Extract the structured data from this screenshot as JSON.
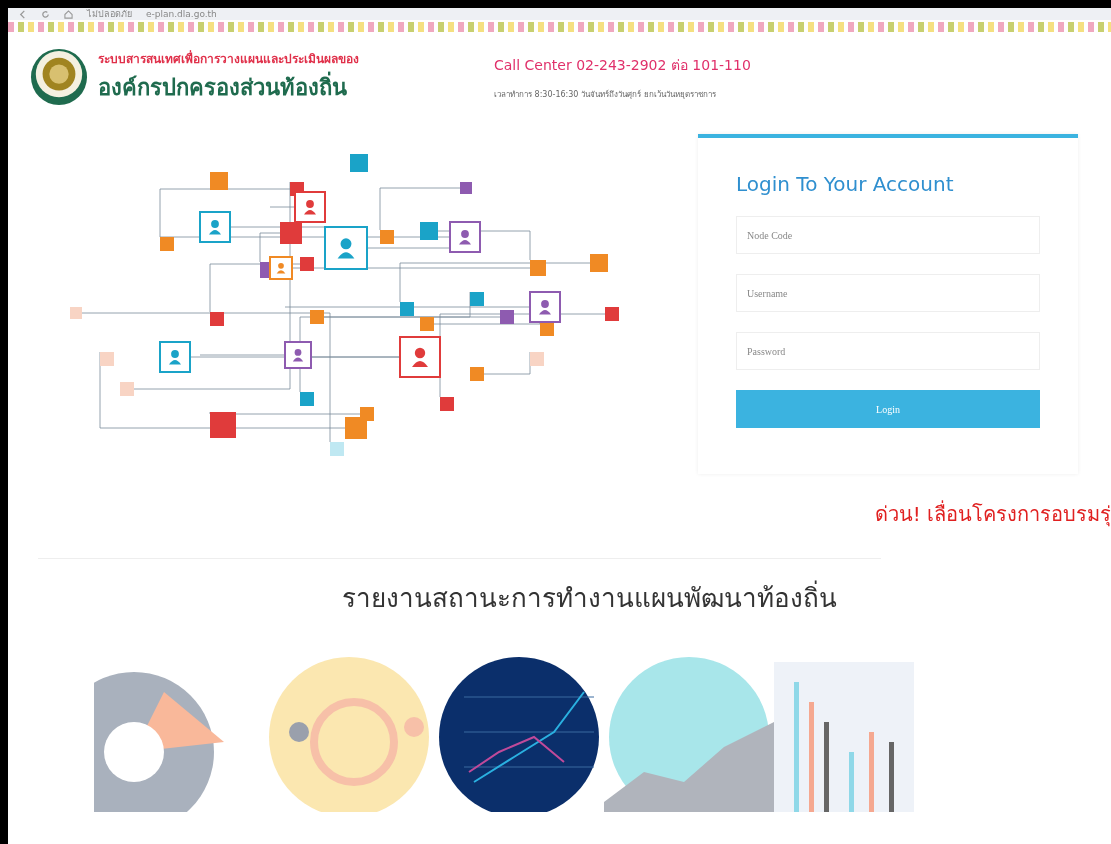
{
  "browser_bar": {
    "security": "ไม่ปลอดภัย",
    "url": "e-plan.dla.go.th"
  },
  "header": {
    "title_line_1": "ระบบสารสนเทศเพื่อการวางแผนและประเมินผลของ",
    "title_line_2": "องค์กรปกครองส่วนท้องถิ่น",
    "call_center": "Call Center 02-243-2902 ต่อ 101-110",
    "hours": "เวลาทำการ 8:30-16:30 วันจันทร์ถึงวันศุกร์ ยกเว้นวันหยุดราชการ"
  },
  "login": {
    "title": "Login To Your Account",
    "fields": [
      {
        "placeholder": "Node Code"
      },
      {
        "placeholder": "Username"
      },
      {
        "placeholder": "Password"
      }
    ],
    "button": "Login"
  },
  "announcement": "ด่วน! เลื่อนโครงการอบรมรุ่",
  "report": {
    "title": "รายงานสถานะการทำงานแผนพัฒนาท้องถิ่น"
  }
}
